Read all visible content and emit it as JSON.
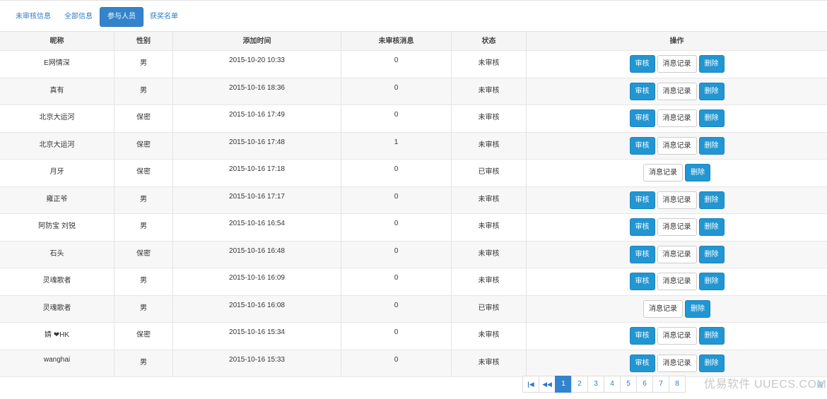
{
  "tabs": [
    {
      "label": "未审核信息",
      "active": false
    },
    {
      "label": "全部信息",
      "active": false
    },
    {
      "label": "参与人员",
      "active": true
    },
    {
      "label": "获奖名单",
      "active": false
    }
  ],
  "table": {
    "columns": [
      "昵称",
      "性别",
      "添加时间",
      "未审核消息",
      "状态",
      "操作"
    ],
    "rows": [
      {
        "nickname": "E网情深",
        "gender": "男",
        "added": "2015-10-20 10:33",
        "unread": "0",
        "status": "未审核",
        "actions": [
          "审核",
          "消息记录",
          "删除"
        ]
      },
      {
        "nickname": "真有",
        "gender": "男",
        "added": "2015-10-16 18:36",
        "unread": "0",
        "status": "未审核",
        "actions": [
          "审核",
          "消息记录",
          "删除"
        ]
      },
      {
        "nickname": "北京大运河",
        "gender": "保密",
        "added": "2015-10-16 17:49",
        "unread": "0",
        "status": "未审核",
        "actions": [
          "审核",
          "消息记录",
          "删除"
        ]
      },
      {
        "nickname": "北京大运河",
        "gender": "保密",
        "added": "2015-10-16 17:48",
        "unread": "1",
        "status": "未审核",
        "actions": [
          "审核",
          "消息记录",
          "删除"
        ]
      },
      {
        "nickname": "月牙",
        "gender": "保密",
        "added": "2015-10-16 17:18",
        "unread": "0",
        "status": "已审核",
        "actions": [
          "消息记录",
          "删除"
        ]
      },
      {
        "nickname": "雍正爷",
        "gender": "男",
        "added": "2015-10-16 17:17",
        "unread": "0",
        "status": "未审核",
        "actions": [
          "审核",
          "消息记录",
          "删除"
        ]
      },
      {
        "nickname": "阿防宝 刘锐",
        "gender": "男",
        "added": "2015-10-16 16:54",
        "unread": "0",
        "status": "未审核",
        "actions": [
          "审核",
          "消息记录",
          "删除"
        ]
      },
      {
        "nickname": "石头",
        "gender": "保密",
        "added": "2015-10-16 16:48",
        "unread": "0",
        "status": "未审核",
        "actions": [
          "审核",
          "消息记录",
          "删除"
        ]
      },
      {
        "nickname": "灵魂歌者",
        "gender": "男",
        "added": "2015-10-16 16:09",
        "unread": "0",
        "status": "未审核",
        "actions": [
          "审核",
          "消息记录",
          "删除"
        ]
      },
      {
        "nickname": "灵魂歌者",
        "gender": "男",
        "added": "2015-10-16 16:08",
        "unread": "0",
        "status": "已审核",
        "actions": [
          "消息记录",
          "删除"
        ]
      },
      {
        "nickname": "婧 ❤HK",
        "gender": "保密",
        "added": "2015-10-16 15:34",
        "unread": "0",
        "status": "未审核",
        "actions": [
          "审核",
          "消息记录",
          "删除"
        ]
      },
      {
        "nickname": "wanghai",
        "gender": "男",
        "added": "2015-10-16 15:33",
        "unread": "0",
        "status": "未审核",
        "actions": [
          "审核",
          "消息记录",
          "删除"
        ]
      }
    ]
  },
  "pagination": {
    "first_icon": "first-page-icon",
    "first_label": "|◀",
    "prev_icon": "prev-page-icon",
    "prev_label": "◀◀",
    "pages": [
      "1",
      "2",
      "3",
      "4",
      "5",
      "6",
      "7",
      "8"
    ],
    "current": "1"
  },
  "watermark": "优易软件 UUECS.COM",
  "corner_label": "返"
}
